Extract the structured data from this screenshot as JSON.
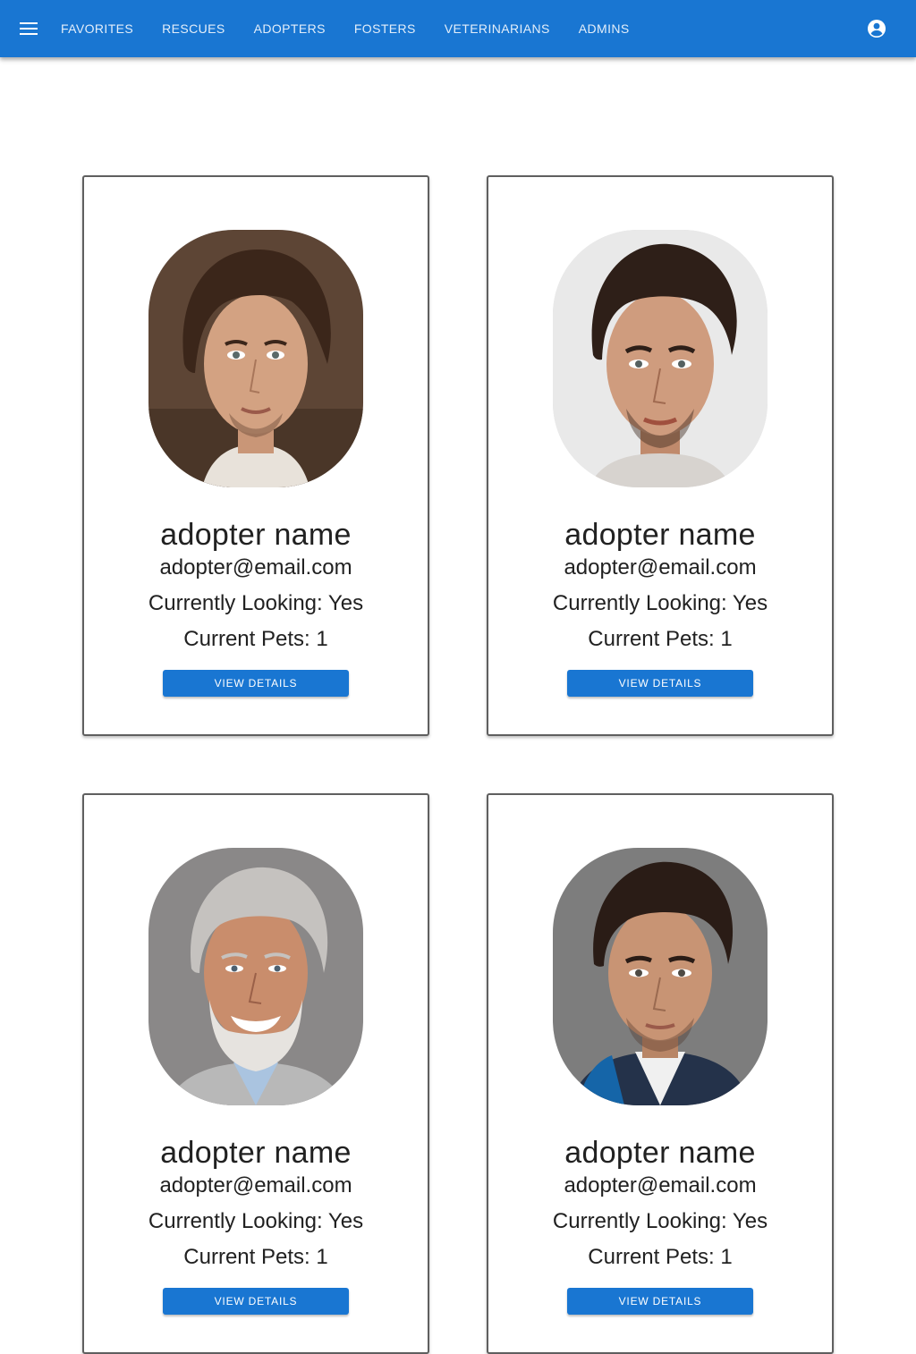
{
  "appbar": {
    "color": "#1976d2",
    "menu_icon": "hamburger-menu-icon",
    "nav_items": [
      {
        "label": "FAVORITES"
      },
      {
        "label": "RESCUES"
      },
      {
        "label": "ADOPTERS"
      },
      {
        "label": "FOSTERS"
      },
      {
        "label": "VETERINARIANS"
      },
      {
        "label": "ADMINS"
      }
    ],
    "account_icon": "account-circle-icon"
  },
  "adopters": [
    {
      "name": "adopter name",
      "email": "adopter@email.com",
      "looking": "Currently Looking: Yes",
      "pets": "Current Pets: 1",
      "button": "VIEW DETAILS",
      "photo": "portrait-man-long-wavy-hair"
    },
    {
      "name": "adopter name",
      "email": "adopter@email.com",
      "looking": "Currently Looking: Yes",
      "pets": "Current Pets: 1",
      "button": "VIEW DETAILS",
      "photo": "portrait-man-dark-hair-stubble"
    },
    {
      "name": "adopter name",
      "email": "adopter@email.com",
      "looking": "Currently Looking: Yes",
      "pets": "Current Pets: 1",
      "button": "VIEW DETAILS",
      "photo": "portrait-older-man-gray-beard"
    },
    {
      "name": "adopter name",
      "email": "adopter@email.com",
      "looking": "Currently Looking: Yes",
      "pets": "Current Pets: 1",
      "button": "VIEW DETAILS",
      "photo": "portrait-man-suit-blue-jacket"
    }
  ]
}
